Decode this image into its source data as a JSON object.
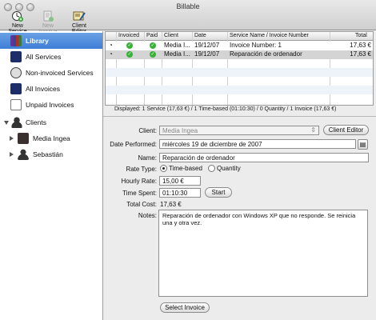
{
  "window": {
    "title": "Billable"
  },
  "toolbar": {
    "new_service": "New Service",
    "new_invoice": "New Invoice",
    "client_editor": "Client Editor"
  },
  "sidebar": {
    "library": "Library",
    "all_services": "All Services",
    "non_invoiced": "Non-invoiced Services",
    "all_invoices": "All Invoices",
    "unpaid_invoices": "Unpaid Invoices",
    "clients": "Clients",
    "client1": "Media Ingea",
    "client2": "Sebastián"
  },
  "table": {
    "columns": [
      "Invoiced",
      "Paid",
      "Client",
      "Date",
      "Service Name / Invoice Number",
      "Total"
    ],
    "rows": [
      {
        "client": "Media I...",
        "date": "19/12/07",
        "name": "Invoice Number: 1",
        "total": "17,63 €"
      },
      {
        "client": "Media I...",
        "date": "19/12/07",
        "name": "Reparación de ordenador",
        "total": "17,63 €"
      }
    ]
  },
  "status": "Displayed: 1 Service (17,63 €) / 1 Time-based (01:10:30) / 0 Quantity / 1 Invoice (17,63 €)",
  "form": {
    "client_label": "Client:",
    "client_value": "Media Ingea",
    "client_editor_btn": "Client Editor",
    "date_label": "Date Performed:",
    "date_value": "miércoles 19 de diciembre de 2007",
    "name_label": "Name:",
    "name_value": "Reparación de ordenador",
    "rate_type_label": "Rate Type:",
    "rate_time": "Time-based",
    "rate_quantity": "Quantity",
    "hourly_label": "Hourly Rate:",
    "hourly_value": "15,00 €",
    "time_label": "Time Spent:",
    "time_value": "01:10:30",
    "start_btn": "Start",
    "total_label": "Total Cost:",
    "total_value": "17,63 €",
    "notes_label": "Notes:",
    "notes_value": "Reparación de ordenador con Windows XP que no responde. Se reinicia una y otra vez.",
    "select_invoice_btn": "Select Invoice"
  }
}
